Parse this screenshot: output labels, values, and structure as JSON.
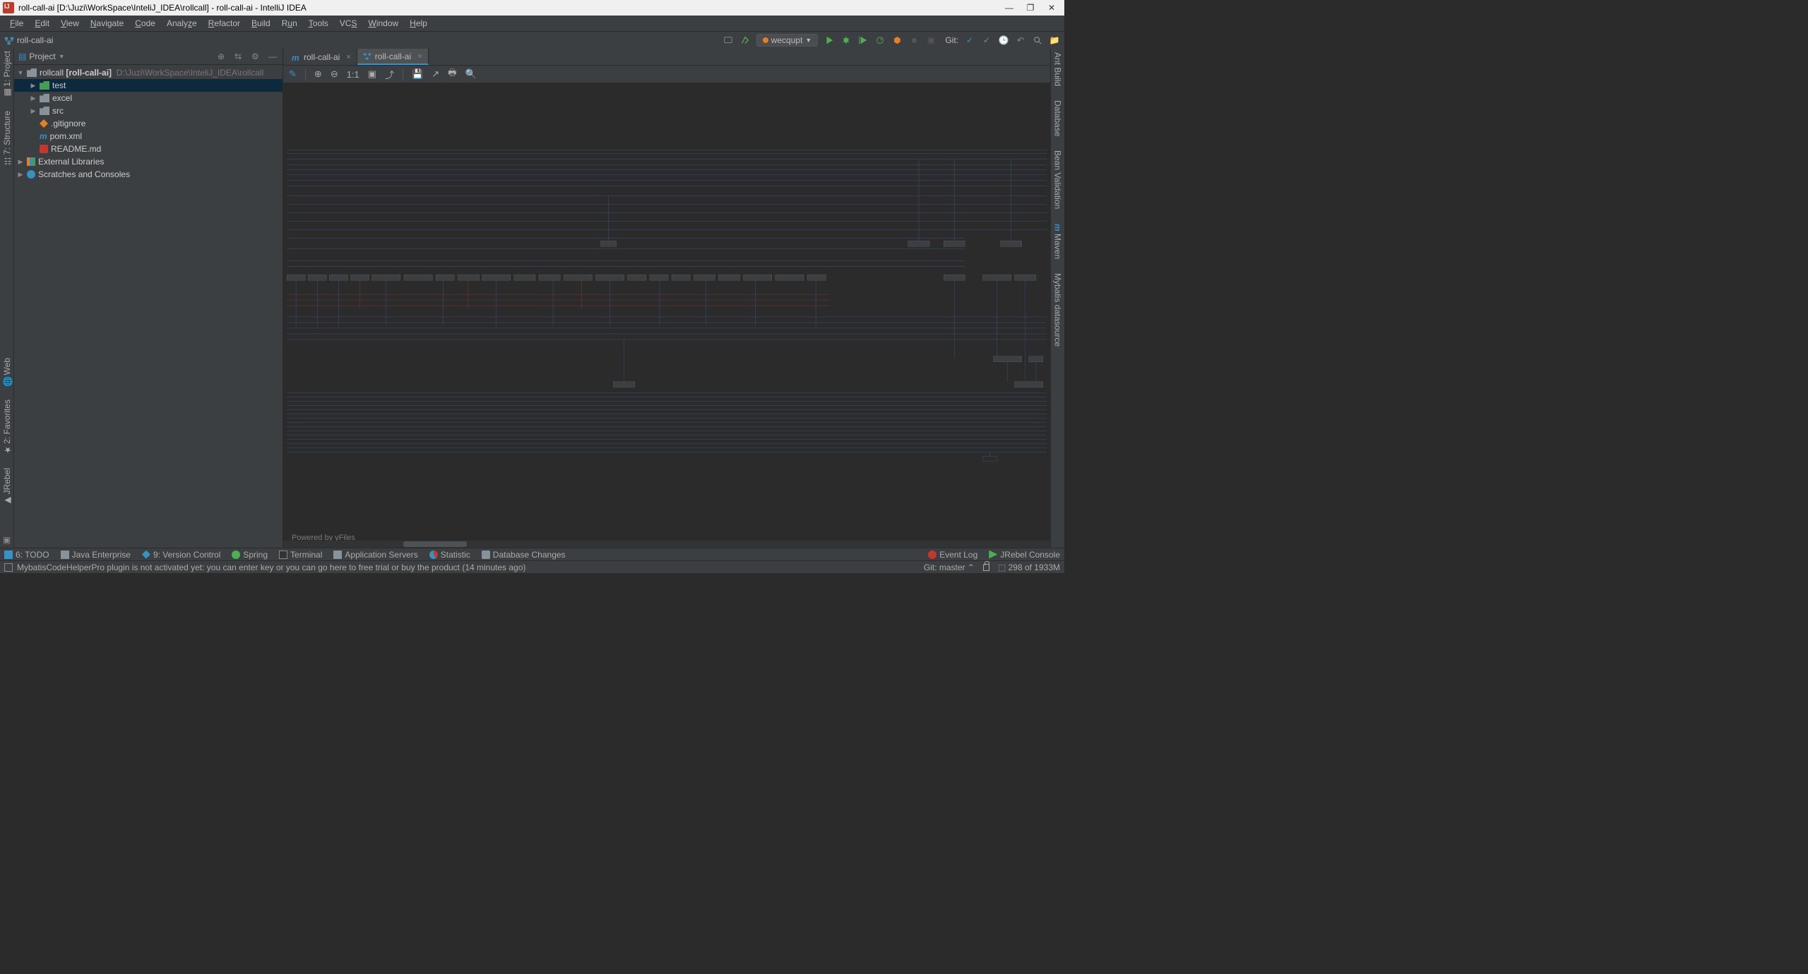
{
  "titlebar": {
    "title": "roll-call-ai [D:\\Juzi\\WorkSpace\\InteliJ_IDEA\\rollcall] - roll-call-ai - IntelliJ IDEA"
  },
  "menubar": {
    "items": [
      "File",
      "Edit",
      "View",
      "Navigate",
      "Code",
      "Analyze",
      "Refactor",
      "Build",
      "Run",
      "Tools",
      "VCS",
      "Window",
      "Help"
    ]
  },
  "breadcrumb": {
    "root": "roll-call-ai"
  },
  "toolbar": {
    "run_config": "wecqupt",
    "git_label": "Git:"
  },
  "left_tool_windows": {
    "top": [
      "1: Project",
      "7: Structure"
    ],
    "bottom": [
      "Web",
      "2: Favorites",
      "JRebel"
    ]
  },
  "right_tool_windows": [
    "Ant Build",
    "Database",
    "Bean Validation",
    "Maven",
    "Mybatis datasource"
  ],
  "project_panel": {
    "title": "Project",
    "root_name": "rollcall",
    "root_bold": "[roll-call-ai]",
    "root_path": "D:\\Juzi\\WorkSpace\\InteliJ_IDEA\\rollcall",
    "items": [
      {
        "name": "test",
        "type": "folder-test",
        "indent": 2,
        "expandable": true
      },
      {
        "name": "excel",
        "type": "folder",
        "indent": 2,
        "expandable": true
      },
      {
        "name": "src",
        "type": "folder",
        "indent": 2,
        "expandable": true
      },
      {
        "name": ".gitignore",
        "type": "git",
        "indent": 2,
        "expandable": false
      },
      {
        "name": "pom.xml",
        "type": "m",
        "indent": 2,
        "expandable": false,
        "blue": true
      },
      {
        "name": "README.md",
        "type": "md",
        "indent": 2,
        "expandable": false
      }
    ],
    "external": "External Libraries",
    "scratches": "Scratches and Consoles"
  },
  "tabs": [
    {
      "label": "roll-call-ai",
      "icon": "m",
      "active": false
    },
    {
      "label": "roll-call-ai",
      "icon": "diagram",
      "active": true
    }
  ],
  "diagram": {
    "powered": "Powered by yFiles"
  },
  "bottom_tools": {
    "left": [
      {
        "label": "6: TODO",
        "icon": "todo"
      },
      {
        "label": "Java Enterprise",
        "icon": "je"
      },
      {
        "label": "9: Version Control",
        "icon": "vc"
      },
      {
        "label": "Spring",
        "icon": "spring"
      },
      {
        "label": "Terminal",
        "icon": "term"
      },
      {
        "label": "Application Servers",
        "icon": "as"
      },
      {
        "label": "Statistic",
        "icon": "stat"
      },
      {
        "label": "Database Changes",
        "icon": "db"
      }
    ],
    "right": [
      {
        "label": "Event Log",
        "icon": "err"
      },
      {
        "label": "JRebel Console",
        "icon": "jr"
      }
    ]
  },
  "statusbar": {
    "message": "MybatisCodeHelperPro plugin is not activated yet: you can enter key or you can go here to free trial or buy the product (14 minutes ago)",
    "git_branch": "Git: master",
    "memory": "298 of 1933M"
  }
}
